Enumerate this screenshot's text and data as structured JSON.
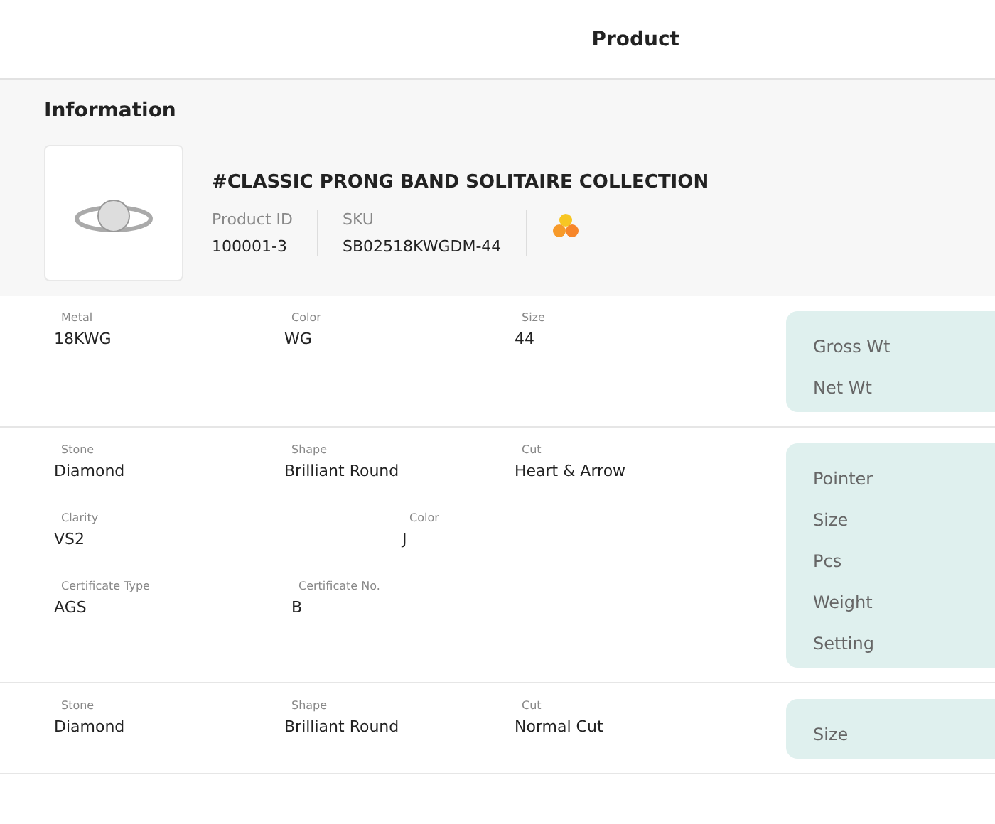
{
  "header": {
    "title": "Product"
  },
  "information": {
    "heading": "Information",
    "product_name": "#CLASSIC PRONG BAND SOLITAIRE COLLECTION",
    "meta": [
      {
        "label": "Product ID",
        "value": "100001-3"
      },
      {
        "label": "SKU",
        "value": "SB02518KWGDM-44"
      }
    ]
  },
  "sections": [
    {
      "rows": [
        [
          {
            "label": "Metal",
            "value": "18KWG"
          },
          {
            "label": "Color",
            "value": "WG"
          },
          {
            "label": "Size",
            "value": "44"
          }
        ]
      ],
      "panel": [
        "Gross Wt",
        "Net Wt"
      ]
    },
    {
      "rows": [
        [
          {
            "label": "Stone",
            "value": "Diamond"
          },
          {
            "label": "Shape",
            "value": "Brilliant Round"
          },
          {
            "label": "Cut",
            "value": "Heart & Arrow"
          }
        ],
        [
          {
            "label": "Clarity",
            "value": "VS2"
          },
          {
            "label": "Color",
            "value": "J"
          }
        ],
        [
          {
            "label": "Certificate Type",
            "value": "AGS"
          },
          {
            "label": "Certificate No.",
            "value": "B"
          }
        ]
      ],
      "panel": [
        "Pointer",
        "Size",
        "Pcs",
        "Weight",
        "Setting"
      ]
    },
    {
      "rows": [
        [
          {
            "label": "Stone",
            "value": "Diamond"
          },
          {
            "label": "Shape",
            "value": "Brilliant Round"
          },
          {
            "label": "Cut",
            "value": "Normal Cut"
          }
        ]
      ],
      "panel": [
        "Size"
      ]
    }
  ]
}
